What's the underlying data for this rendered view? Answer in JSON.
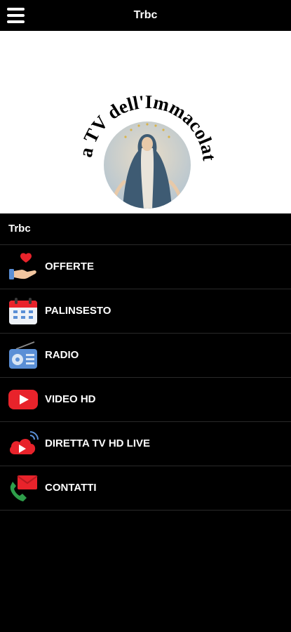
{
  "header": {
    "title": "Trbc",
    "menu_icon": "hamburger-menu-icon"
  },
  "banner": {
    "logo_text": "La TV dell'Immacolata",
    "logo_image": "madonna-image"
  },
  "section": {
    "title": "Trbc"
  },
  "menu": {
    "items": [
      {
        "label": "OFFERTE",
        "icon": "heart-hand-icon"
      },
      {
        "label": "PALINSESTO",
        "icon": "calendar-icon"
      },
      {
        "label": "RADIO",
        "icon": "radio-icon"
      },
      {
        "label": "VIDEO HD",
        "icon": "youtube-play-icon"
      },
      {
        "label": "DIRETTA TV HD LIVE",
        "icon": "live-stream-icon"
      },
      {
        "label": "CONTATTI",
        "icon": "mail-phone-icon"
      }
    ]
  },
  "colors": {
    "background": "#000000",
    "banner": "#ffffff",
    "accent_red": "#e8232b",
    "accent_blue": "#5a8fd6"
  }
}
